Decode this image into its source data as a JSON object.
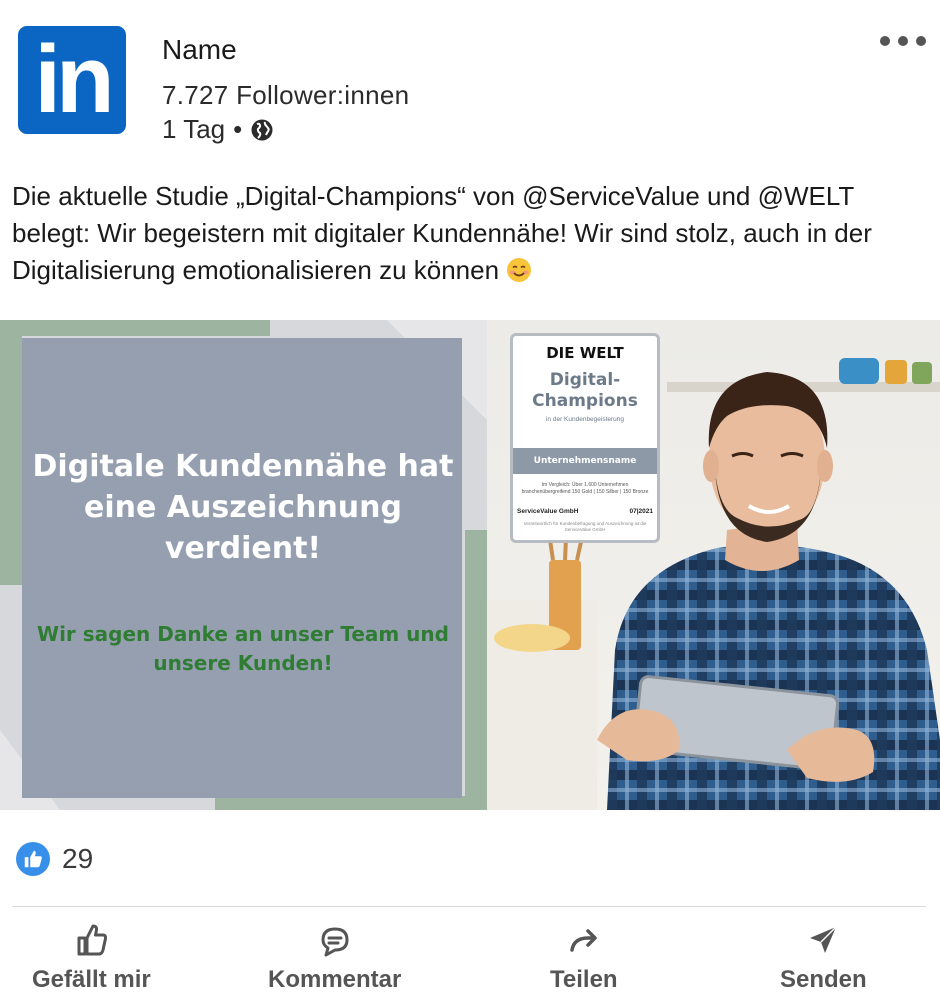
{
  "post": {
    "author": {
      "logo_text": "in",
      "name": "Name",
      "followers": "7.727 Follower:innen",
      "time": "1 Tag",
      "separator": "•",
      "visibility_icon": "globe-icon"
    },
    "menu_icon": "more-horizontal-icon",
    "text": "Die aktuelle Studie „Digital-Champions“ von @ServiceValue und @WELT belegt: Wir begeistern mit digitaler Kundennähe! Wir sind stolz, auch in der Digitalisierung emotionalisieren zu können",
    "emoji": "smiling-face-emoji"
  },
  "media": {
    "headline": "Digitale Kundennähe hat eine Auszeichnung verdient!",
    "thanks": "Wir sagen Danke an unser Team und unsere Kunden!",
    "badge": {
      "brand": "DIE WELT",
      "title": "Digital-Champions",
      "subtitle": "in der Kundenbegeisterung",
      "company": "Unternehmensname",
      "fine_print": "Im Vergleich: Über 1.600 Unternehmen branchenübergreifend 150 Gold | 150 Silber | 150 Bronze",
      "provider": "ServiceValue GmbH",
      "date": "07|2021",
      "note": "Verantwortlich für Kundenbefragung und Auszeichnung ist die ServiceValue GmbH"
    }
  },
  "reactions": {
    "icon": "like-icon",
    "count": "29"
  },
  "actions": [
    {
      "label": "Gefällt mir",
      "icon": "thumbs-up-icon"
    },
    {
      "label": "Kommentar",
      "icon": "comment-icon"
    },
    {
      "label": "Teilen",
      "icon": "share-icon"
    },
    {
      "label": "Senden",
      "icon": "send-icon"
    }
  ],
  "colors": {
    "linkedin_blue": "#0a66c2",
    "like_blue": "#378fe9",
    "panel_slate": "#959fb0",
    "accent_green": "#2e7d32"
  }
}
